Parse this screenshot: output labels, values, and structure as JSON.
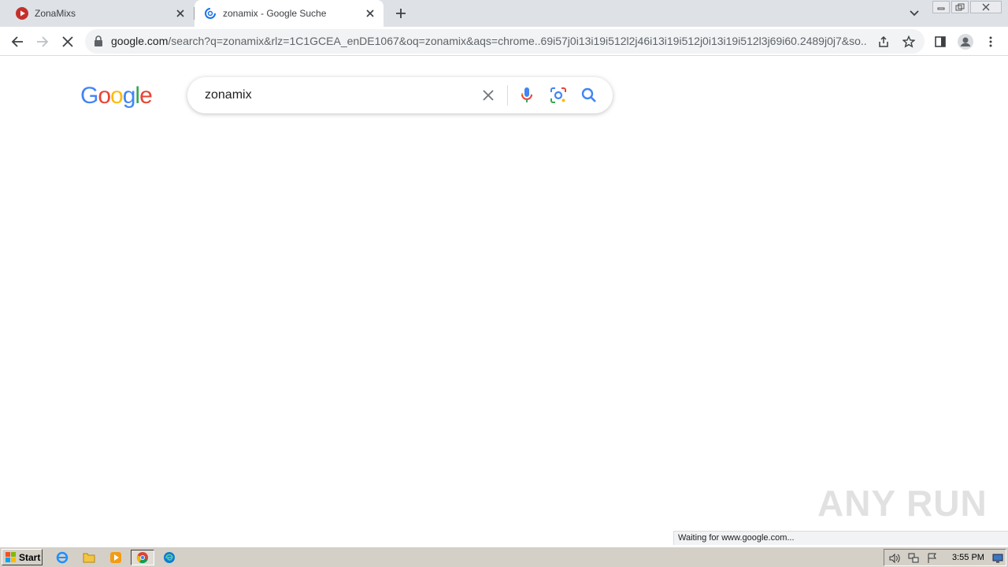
{
  "browser": {
    "tabs": [
      {
        "title": "ZonaMixs",
        "favicon": "youtube-icon",
        "active": false
      },
      {
        "title": "zonamix - Google Suche",
        "favicon": "google-loading-icon",
        "active": true
      }
    ],
    "address_host": "google.com",
    "address_path": "/search?q=zonamix&rlz=1C1GCEA_enDE1067&oq=zonamix&aqs=chrome..69i57j0i13i19i512l2j46i13i19i512j0i13i19i512l3j69i60.2489j0j7&so..."
  },
  "page": {
    "logo_letters": [
      "G",
      "o",
      "o",
      "g",
      "l",
      "e"
    ],
    "logo_colors": [
      "#4285F4",
      "#EA4335",
      "#FBBC05",
      "#4285F4",
      "#34A853",
      "#EA4335"
    ],
    "search_query": "zonamix"
  },
  "status_text": "Waiting for www.google.com...",
  "watermark": "ANY RUN",
  "taskbar": {
    "start_label": "Start",
    "clock": "3:55 PM"
  }
}
